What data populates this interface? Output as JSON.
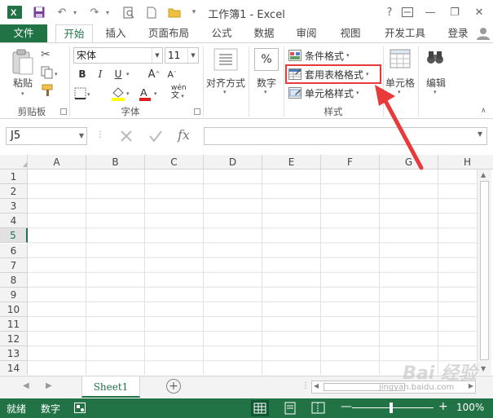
{
  "window": {
    "title": "工作簿1 - Excel",
    "help": "?",
    "minimize": "—",
    "restore": "❐",
    "close": "✕"
  },
  "tabs": {
    "file": "文件",
    "home": "开始",
    "insert": "插入",
    "page_layout": "页面布局",
    "formulas": "公式",
    "data": "数据",
    "review": "审阅",
    "view": "视图",
    "developer": "开发工具",
    "login": "登录"
  },
  "ribbon": {
    "clipboard": {
      "paste_label": "粘贴",
      "group_label": "剪贴板"
    },
    "font": {
      "font_name": "宋体",
      "font_size": "11",
      "bold": "B",
      "italic": "I",
      "underline": "U",
      "grow": "A",
      "shrink": "A",
      "phonetic": "wén",
      "group_label": "字体",
      "highlight_color": "#ffff00",
      "font_color": "#e02020"
    },
    "alignment": {
      "label": "对齐方式"
    },
    "number": {
      "symbol": "%",
      "label": "数字"
    },
    "styles": {
      "conditional_formatting": "条件格式",
      "format_as_table": "套用表格格式",
      "cell_styles": "单元格样式",
      "group_label": "样式"
    },
    "cells": {
      "label": "单元格"
    },
    "editing": {
      "label": "编辑"
    }
  },
  "formula_bar": {
    "name_box": "J5",
    "fx": "fx"
  },
  "grid": {
    "columns": [
      "A",
      "B",
      "C",
      "D",
      "E",
      "F",
      "G",
      "H"
    ],
    "rows": [
      "1",
      "2",
      "3",
      "4",
      "5",
      "6",
      "7",
      "8",
      "9",
      "10",
      "11",
      "12",
      "13",
      "14"
    ],
    "selected_row": "5"
  },
  "sheets": {
    "tabs": [
      "Sheet1"
    ],
    "add_sheet": "+"
  },
  "status": {
    "ready": "就绪",
    "num_lock": "数字",
    "zoom": "100%"
  },
  "annotation": {
    "watermark": "Bai 经验",
    "watermark_url": "jingyan.baidu.com"
  },
  "colors": {
    "accent": "#217346",
    "highlight": "#e83a3a"
  }
}
